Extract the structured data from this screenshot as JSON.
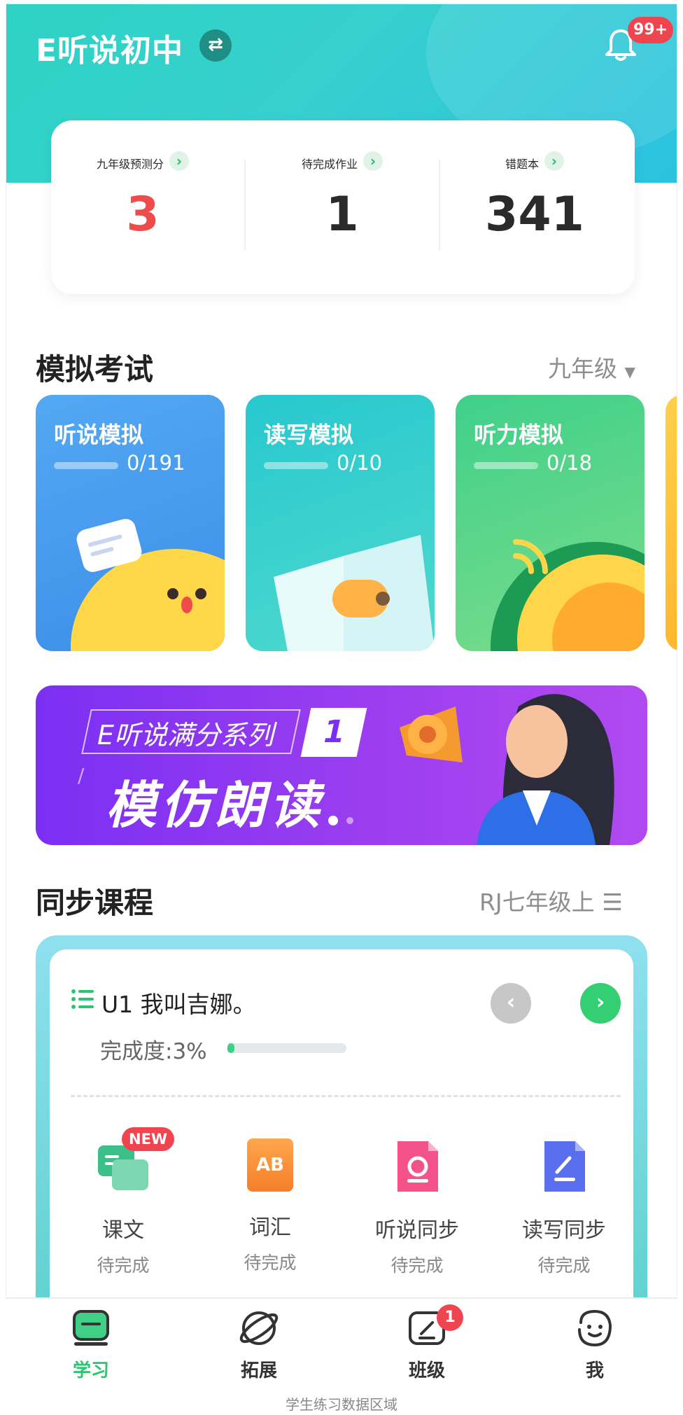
{
  "header": {
    "app_title": "E听说初中",
    "switch_icon": "swap-icon",
    "notification_badge": "99+"
  },
  "stats": [
    {
      "label": "九年级预测分",
      "value": "3",
      "color": "#ee4b4b"
    },
    {
      "label": "待完成作业",
      "value": "1",
      "color": "#2a2a2a"
    },
    {
      "label": "错题本",
      "value": "341",
      "color": "#2a2a2a"
    }
  ],
  "mock_exam": {
    "title": "模拟考试",
    "grade_filter": "九年级",
    "cards": [
      {
        "name": "听说模拟",
        "progress": "0/191",
        "done": 0,
        "total": 191
      },
      {
        "name": "读写模拟",
        "progress": "0/10",
        "done": 0,
        "total": 10
      },
      {
        "name": "听力模拟",
        "progress": "0/18",
        "done": 0,
        "total": 18
      }
    ]
  },
  "banner": {
    "series": "E听说满分系列",
    "number": "1",
    "headline": "模仿朗读",
    "page_indicator": {
      "current": 1,
      "total": 2
    }
  },
  "sync_course": {
    "title": "同步课程",
    "textbook": "RJ七年级上",
    "unit_title": "U1 我叫吉娜。",
    "progress_label": "完成度:3%",
    "progress_fraction": 0.03,
    "modules": [
      {
        "label": "课文",
        "status": "待完成",
        "badge": "NEW",
        "icon": "text-chat-icon"
      },
      {
        "label": "词汇",
        "status": "待完成",
        "badge": "",
        "icon": "ab-book-icon",
        "icon_text": "AB"
      },
      {
        "label": "听说同步",
        "status": "待完成",
        "badge": "",
        "icon": "listen-doc-icon"
      },
      {
        "label": "读写同步",
        "status": "待完成",
        "badge": "",
        "icon": "write-doc-icon"
      }
    ]
  },
  "tabbar": {
    "tabs": [
      {
        "label": "学习",
        "icon": "study-icon",
        "active": true
      },
      {
        "label": "拓展",
        "icon": "planet-icon",
        "active": false
      },
      {
        "label": "班级",
        "icon": "class-icon",
        "active": false,
        "badge": "1"
      },
      {
        "label": "我",
        "icon": "smile-icon",
        "active": false
      }
    ]
  },
  "caption": "学生练习数据区域",
  "colors": {
    "accent_green": "#2cc56f",
    "highlight_red": "#ff3b1f",
    "hero_teal": "#2ed3c3",
    "banner_purple": "#8a35f2"
  }
}
